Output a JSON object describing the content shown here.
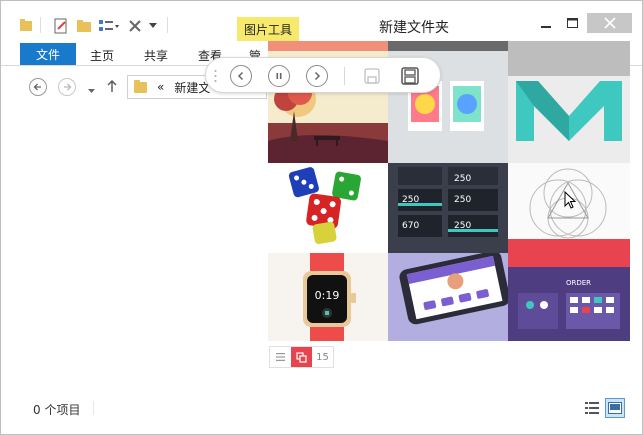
{
  "window": {
    "title": "新建文件夹",
    "context_tab": "图片工具"
  },
  "ribbon": {
    "tabs": [
      "文件",
      "主页",
      "共享",
      "查看",
      "管"
    ]
  },
  "address": {
    "chevron": "«",
    "path": "新建文"
  },
  "pager": {
    "count": "15"
  },
  "status": {
    "item_count": "0 个项目"
  },
  "images": {
    "dice_color": "#d62424",
    "accent_red": "#e8444f",
    "teal": "#3ec8c0"
  },
  "watch": {
    "time": "0:19"
  },
  "order": {
    "label": "ORDER"
  },
  "dark_cards": {
    "numbers": [
      "250",
      "250",
      "670",
      "250",
      "250"
    ]
  }
}
